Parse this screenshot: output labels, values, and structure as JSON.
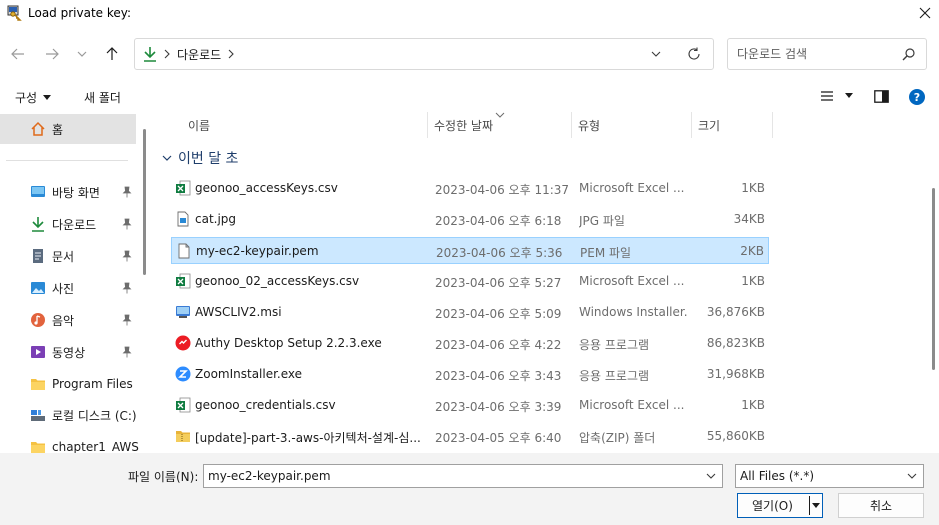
{
  "window": {
    "title": "Load private key:"
  },
  "address": {
    "crumb": "다운로드"
  },
  "search": {
    "placeholder": "다운로드 검색"
  },
  "toolbar": {
    "organize": "구성",
    "new_folder": "새 폴더"
  },
  "sidebar": {
    "home": "홈",
    "items": [
      {
        "label": "바탕 화면",
        "icon": "desktop-icon",
        "pinned": true
      },
      {
        "label": "다운로드",
        "icon": "download-icon",
        "pinned": true
      },
      {
        "label": "문서",
        "icon": "document-icon",
        "pinned": true
      },
      {
        "label": "사진",
        "icon": "picture-icon",
        "pinned": true
      },
      {
        "label": "음악",
        "icon": "music-icon",
        "pinned": true
      },
      {
        "label": "동영상",
        "icon": "video-icon",
        "pinned": true
      },
      {
        "label": "Program Files",
        "icon": "folder-icon",
        "pinned": false
      },
      {
        "label": "로컬 디스크 (C:)",
        "icon": "drive-icon",
        "pinned": false
      },
      {
        "label": "chapter1_AWS",
        "icon": "folder-icon",
        "pinned": false
      }
    ]
  },
  "columns": {
    "name": "이름",
    "date": "수정한 날짜",
    "type": "유형",
    "size": "크기"
  },
  "group": {
    "label": "이번 달 초"
  },
  "files": [
    {
      "name": "geonoo_accessKeys.csv",
      "date": "2023-04-06 오후 11:37",
      "type": "Microsoft Excel ...",
      "size": "1KB",
      "icon": "excel-icon"
    },
    {
      "name": "cat.jpg",
      "date": "2023-04-06 오후 6:18",
      "type": "JPG 파일",
      "size": "34KB",
      "icon": "image-file-icon"
    },
    {
      "name": "my-ec2-keypair.pem",
      "date": "2023-04-06 오후 5:36",
      "type": "PEM 파일",
      "size": "2KB",
      "icon": "blank-file-icon",
      "selected": true
    },
    {
      "name": "geonoo_02_accessKeys.csv",
      "date": "2023-04-06 오후 5:27",
      "type": "Microsoft Excel ...",
      "size": "1KB",
      "icon": "excel-icon"
    },
    {
      "name": "AWSCLIV2.msi",
      "date": "2023-04-06 오후 5:09",
      "type": "Windows Installer...",
      "size": "36,876KB",
      "icon": "installer-icon"
    },
    {
      "name": "Authy Desktop Setup 2.2.3.exe",
      "date": "2023-04-06 오후 4:22",
      "type": "응용 프로그램",
      "size": "86,823KB",
      "icon": "authy-icon"
    },
    {
      "name": "ZoomInstaller.exe",
      "date": "2023-04-06 오후 3:43",
      "type": "응용 프로그램",
      "size": "31,968KB",
      "icon": "zoom-icon"
    },
    {
      "name": "geonoo_credentials.csv",
      "date": "2023-04-06 오후 3:39",
      "type": "Microsoft Excel ...",
      "size": "1KB",
      "icon": "excel-icon"
    },
    {
      "name": "[update]-part-3.-aws-아키텍처-설계-심...",
      "date": "2023-04-05 오후 6:40",
      "type": "압축(ZIP) 폴더",
      "size": "55,860KB",
      "icon": "zip-folder-icon"
    }
  ],
  "footer": {
    "filename_label": "파일 이름(N):",
    "filename_value": "my-ec2-keypair.pem",
    "filetype": "All Files (*.*)",
    "open_label": "열기(O)",
    "cancel_label": "취소"
  }
}
